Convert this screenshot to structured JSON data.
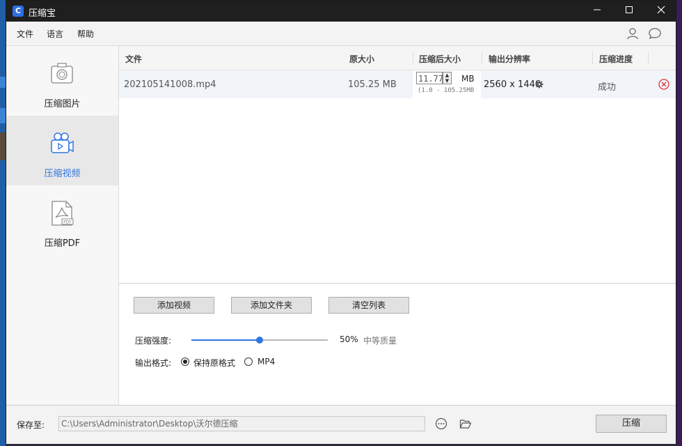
{
  "window": {
    "title": "压缩宝"
  },
  "menu": {
    "file": "文件",
    "language": "语言",
    "help": "帮助"
  },
  "sidebar": {
    "items": [
      {
        "label": "压缩图片",
        "icon": "camera-icon"
      },
      {
        "label": "压缩视频",
        "icon": "video-camera-icon",
        "active": true
      },
      {
        "label": "压缩PDF",
        "icon": "pdf-file-icon"
      }
    ]
  },
  "table": {
    "headers": {
      "file": "文件",
      "original": "原大小",
      "compressed": "压缩后大小",
      "resolution": "输出分辨率",
      "progress": "压缩进度"
    },
    "rows": [
      {
        "file": "202105141008.mp4",
        "original": "105.25 MB",
        "target_value": "11.77",
        "target_unit": "MB",
        "target_range": "(1.0 - 105.25MB",
        "resolution": "2560 x 1440",
        "progress": "成功"
      }
    ]
  },
  "controls": {
    "add_video": "添加视频",
    "add_folder": "添加文件夹",
    "clear_list": "清空列表",
    "strength_label": "压缩强度:",
    "strength_percent": "50%",
    "strength_quality": "中等质量",
    "strength_value": 0.5,
    "format_label": "输出格式:",
    "format_keep": "保持原格式",
    "format_mp4": "MP4"
  },
  "footer": {
    "save_label": "保存至:",
    "save_path": "C:\\Users\\Administrator\\Desktop\\沃尔德压缩",
    "compress": "压缩"
  },
  "colors": {
    "accent": "#2f76e0",
    "titlebar": "#1f1f1f",
    "error": "#e0343a"
  }
}
